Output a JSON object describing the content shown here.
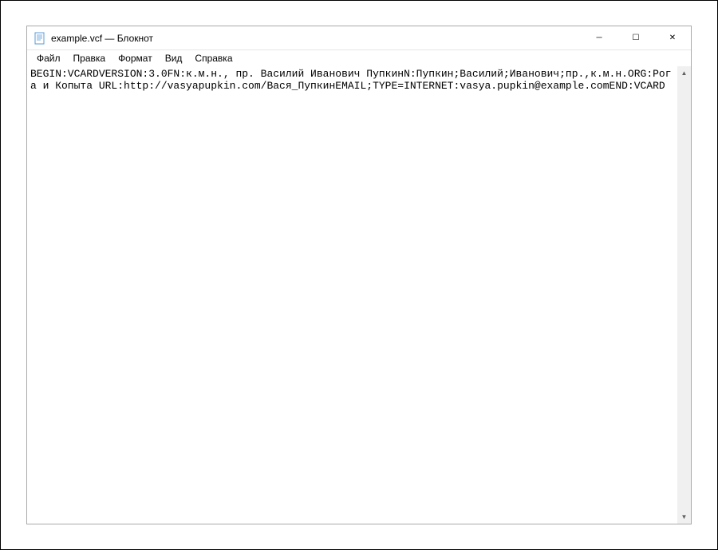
{
  "window": {
    "title": "example.vcf — Блокнот"
  },
  "menu": {
    "file": "Файл",
    "edit": "Правка",
    "format": "Формат",
    "view": "Вид",
    "help": "Справка"
  },
  "content": {
    "text": "BEGIN:VCARDVERSION:3.0FN:к.м.н., пр. Василий Иванович ПупкинN:Пупкин;Василий;Иванович;пр.,к.м.н.ORG:Рога и Копыта URL:http://vasyapupkin.com/Вася_ПупкинEMAIL;TYPE=INTERNET:vasya.pupkin@example.comEND:VCARD"
  },
  "window_controls": {
    "minimize": "─",
    "maximize": "☐",
    "close": "✕"
  },
  "scrollbar": {
    "up": "▲",
    "down": "▼"
  }
}
